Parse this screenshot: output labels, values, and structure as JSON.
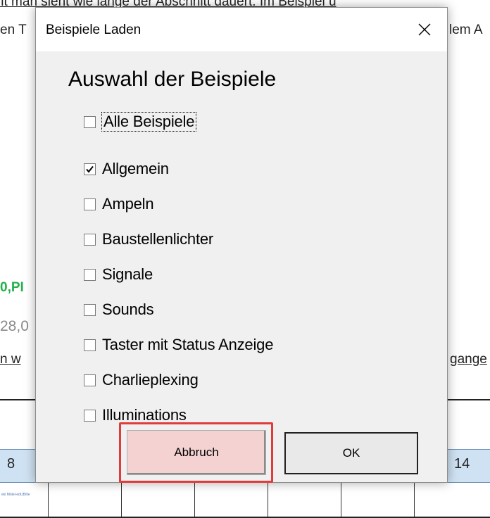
{
  "background": {
    "line1_left": "ıit man sieht wie lange der Abschnitt dauert. Im Beispiel u",
    "line2_left": "en T",
    "line2_right": "lem A",
    "green_text": "0,PI",
    "gray_text": "28,0",
    "line_underlined_left": "n w",
    "line_underlined_right": "gange",
    "cell_left": "8",
    "cell_right": "14",
    "tiny_text": "eki Mölel-edUB/Ile"
  },
  "dialog": {
    "title": "Beispiele Laden",
    "close_glyph": "✕",
    "heading": "Auswahl der Beispiele",
    "options": [
      {
        "label": "Alle Beispiele",
        "checked": false,
        "focused": true
      },
      {
        "label": "Allgemein",
        "checked": true,
        "focused": false
      },
      {
        "label": "Ampeln",
        "checked": false,
        "focused": false
      },
      {
        "label": "Baustellenlichter",
        "checked": false,
        "focused": false
      },
      {
        "label": "Signale",
        "checked": false,
        "focused": false
      },
      {
        "label": "Sounds",
        "checked": false,
        "focused": false
      },
      {
        "label": "Taster mit Status Anzeige",
        "checked": false,
        "focused": false
      },
      {
        "label": "Charlieplexing",
        "checked": false,
        "focused": false
      },
      {
        "label": "Illuminations",
        "checked": false,
        "focused": false
      }
    ],
    "cancel_label": "Abbruch",
    "ok_label": "OK"
  },
  "colors": {
    "green_accent": "#22b04b",
    "highlight_border": "#e03c3c",
    "cell_blue": "#cfe2f3"
  }
}
